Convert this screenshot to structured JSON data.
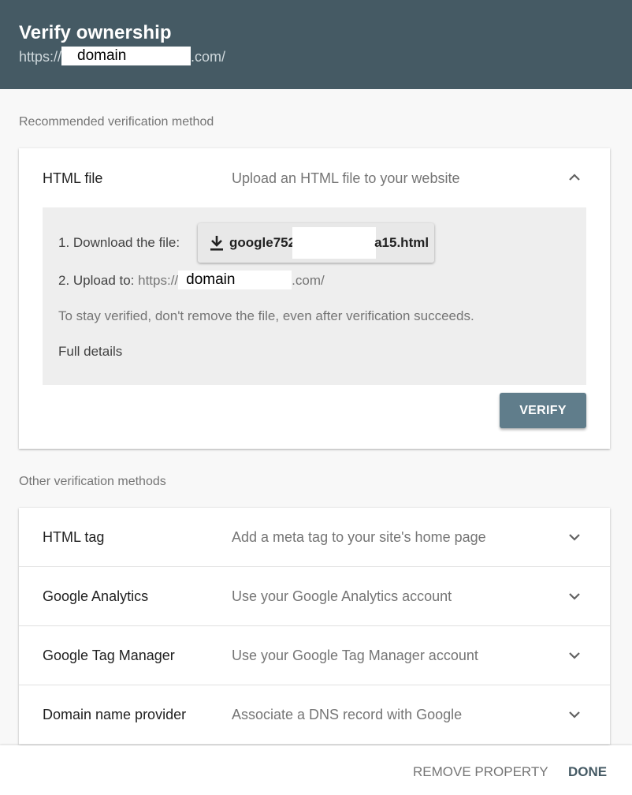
{
  "header": {
    "title": "Verify ownership",
    "url_prefix": "https://",
    "url_redacted": "domain",
    "url_suffix": ".com/"
  },
  "recommended": {
    "section_label": "Recommended verification method",
    "method": {
      "title": "HTML file",
      "description": "Upload an HTML file to your website",
      "expanded": true,
      "step1_label": "1. Download the file:",
      "download_icon": "download-icon",
      "file_prefix": "google752",
      "file_suffix": "a15.html",
      "step2_label": "2. Upload to: ",
      "upload_prefix": "https://",
      "upload_redacted": "domain",
      "upload_suffix": ".com/",
      "note": "To stay verified, don't remove the file, even after verification succeeds.",
      "details_link": "Full details",
      "verify_button": "VERIFY"
    }
  },
  "other": {
    "section_label": "Other verification methods",
    "methods": [
      {
        "title": "HTML tag",
        "description": "Add a meta tag to your site's home page"
      },
      {
        "title": "Google Analytics",
        "description": "Use your Google Analytics account"
      },
      {
        "title": "Google Tag Manager",
        "description": "Use your Google Tag Manager account"
      },
      {
        "title": "Domain name provider",
        "description": "Associate a DNS record with Google"
      }
    ]
  },
  "footer": {
    "remove_button": "REMOVE PROPERTY",
    "done_button": "DONE"
  },
  "colors": {
    "header_bg": "#455a64",
    "verify_bg": "#607d8b",
    "link": "#1a73e8"
  }
}
